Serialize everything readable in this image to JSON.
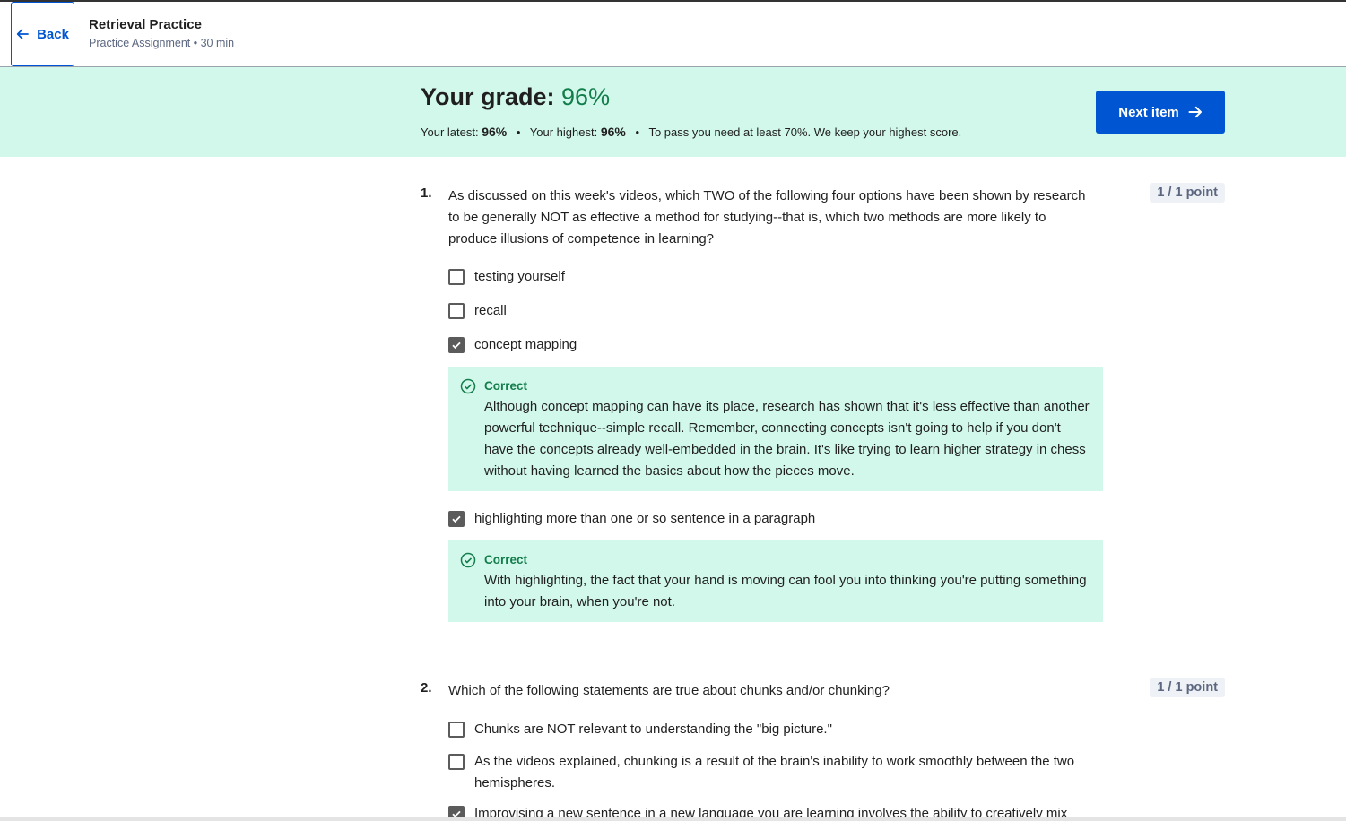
{
  "header": {
    "back_label": "Back",
    "title": "Retrieval Practice",
    "subtitle": "Practice Assignment • 30 min"
  },
  "grade": {
    "label": "Your grade:",
    "value": "96%",
    "latest_label": "Your latest:",
    "latest_value": "96%",
    "highest_label": "Your highest:",
    "highest_value": "96%",
    "separator": "•",
    "pass_note": "To pass you need at least 70%. We keep your highest score.",
    "next_label": "Next item",
    "colors": {
      "banner": "#d2f8ec",
      "grade_value": "#137d4b",
      "primary": "#0056d2"
    }
  },
  "questions": [
    {
      "number": "1.",
      "text": "As discussed on this week's videos, which TWO of the following four options have been shown by research to be generally NOT as effective a method for studying--that is, which two methods are more likely to produce illusions of competence in learning?",
      "points": "1 / 1 point",
      "options": [
        {
          "label": "testing yourself",
          "checked": false
        },
        {
          "label": "recall",
          "checked": false
        },
        {
          "label": "concept mapping",
          "checked": true,
          "feedback_title": "Correct",
          "feedback": "Although concept mapping can have its place, research has shown that it's less effective than another powerful technique--simple recall. Remember, connecting concepts isn't going to help if you don't have the concepts already well-embedded in the brain. It's like trying to learn higher strategy in chess without having learned the basics about how the pieces move."
        },
        {
          "label": "highlighting more than one or so sentence in a paragraph",
          "checked": true,
          "feedback_title": "Correct",
          "feedback": "With highlighting, the fact that your hand is moving can fool you into thinking you're putting something into your brain, when you're not."
        }
      ]
    },
    {
      "number": "2.",
      "text": "Which of the following statements are true about chunks and/or chunking?",
      "points": "1 / 1 point",
      "options": [
        {
          "label": "Chunks are NOT relevant to understanding the \"big picture.\"",
          "checked": false
        },
        {
          "label": "As the videos explained, chunking is a result of the brain's inability to work smoothly between the two hemispheres.",
          "checked": false
        },
        {
          "label": "Improvising a new sentence in a new language you are learning involves the ability to creatively mix",
          "checked": true
        }
      ]
    }
  ]
}
